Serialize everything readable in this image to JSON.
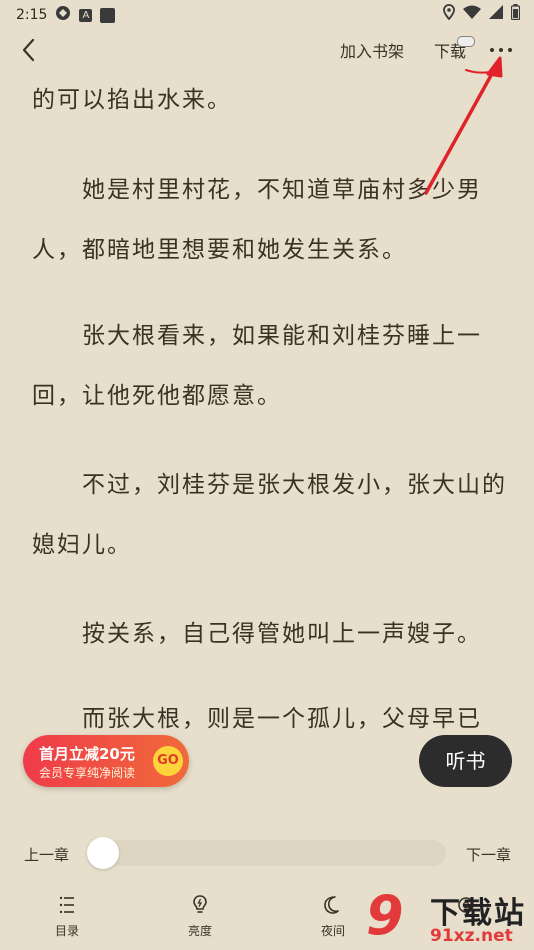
{
  "status_bar": {
    "time": "2:15"
  },
  "top_bar": {
    "add_to_shelf": "加入书架",
    "download": "下载"
  },
  "content": {
    "paragraphs": [
      "的可以掐出水来。",
      "　　她是村里村花，不知道草庙村多少男人，都暗地里想要和她发生关系。",
      "　　张大根看来，如果能和刘桂芬睡上一回，让他死他都愿意。",
      "　　不过，刘桂芬是张大根发小，张大山的媳妇儿。",
      "　　按关系，自己得管她叫上一声嫂子。",
      "　　而张大根，则是一个孤儿，父母早已"
    ]
  },
  "promo": {
    "title": "首月立减20元",
    "subtitle": "会员专享纯净阅读",
    "go": "GO"
  },
  "listen_button": "听书",
  "chapter_nav": {
    "prev": "上一章",
    "next": "下一章",
    "progress": 0.0
  },
  "bottom_nav": {
    "toc": "目录",
    "brightness": "亮度",
    "night": "夜间"
  },
  "watermark": {
    "logo_digit": "9",
    "title": "下载站",
    "url": "91xz.net"
  },
  "colors": {
    "background": "#e7dfcb",
    "text": "#3b3124",
    "arrow": "#e0222a",
    "promo": "#ef3b4a"
  }
}
